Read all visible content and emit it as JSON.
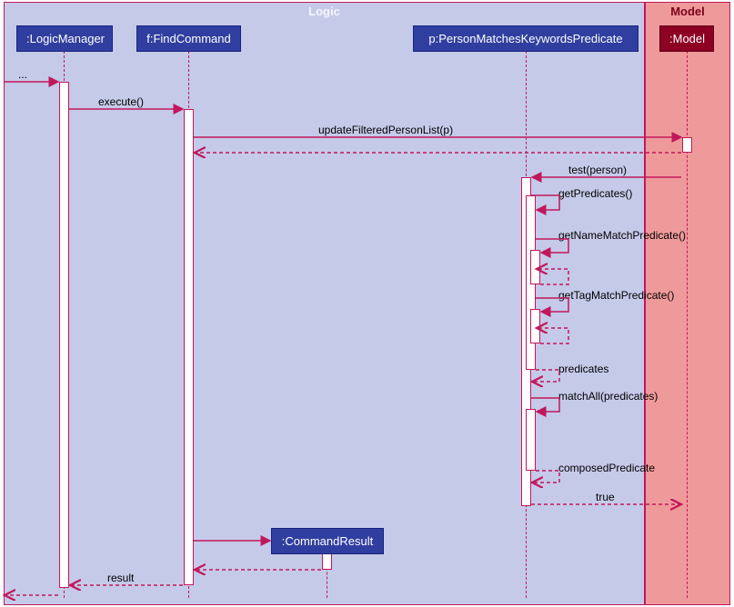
{
  "frames": {
    "logic": {
      "label": "Logic"
    },
    "model": {
      "label": "Model"
    }
  },
  "participants": {
    "logicManager": ":LogicManager",
    "findCommand": "f:FindCommand",
    "predicate": "p:PersonMatchesKeywordsPredicate",
    "commandResult": ":CommandResult",
    "model": ":Model"
  },
  "messages": {
    "dots": "...",
    "execute": "execute()",
    "updateFiltered": "updateFilteredPersonList(p)",
    "testPerson": "test(person)",
    "getPredicates": "getPredicates()",
    "getNameMatch": "getNameMatchPredicate()",
    "getTagMatch": "getTagMatchPredicate()",
    "predicates": "predicates",
    "matchAll": "matchAll(predicates)",
    "composedPredicate": "composedPredicate",
    "returnTrue": "true",
    "result": "result"
  },
  "chart_data": {
    "type": "sequence-diagram",
    "frames": [
      {
        "name": "Logic",
        "participants": [
          ":LogicManager",
          "f:FindCommand",
          "p:PersonMatchesKeywordsPredicate",
          ":CommandResult"
        ]
      },
      {
        "name": "Model",
        "participants": [
          ":Model"
        ]
      }
    ],
    "lifelines": [
      ":LogicManager",
      "f:FindCommand",
      "p:PersonMatchesKeywordsPredicate",
      ":CommandResult",
      ":Model"
    ],
    "interactions": [
      {
        "from": "external",
        "to": ":LogicManager",
        "label": "...",
        "type": "call"
      },
      {
        "from": ":LogicManager",
        "to": "f:FindCommand",
        "label": "execute()",
        "type": "call"
      },
      {
        "from": "f:FindCommand",
        "to": ":Model",
        "label": "updateFilteredPersonList(p)",
        "type": "call"
      },
      {
        "from": ":Model",
        "to": "f:FindCommand",
        "label": "",
        "type": "return"
      },
      {
        "from": ":Model",
        "to": "p:PersonMatchesKeywordsPredicate",
        "label": "test(person)",
        "type": "call"
      },
      {
        "from": "p:PersonMatchesKeywordsPredicate",
        "to": "p:PersonMatchesKeywordsPredicate",
        "label": "getPredicates()",
        "type": "self-call"
      },
      {
        "from": "p:PersonMatchesKeywordsPredicate",
        "to": "p:PersonMatchesKeywordsPredicate",
        "label": "getNameMatchPredicate()",
        "type": "self-call"
      },
      {
        "from": "p:PersonMatchesKeywordsPredicate",
        "to": "p:PersonMatchesKeywordsPredicate",
        "label": "getTagMatchPredicate()",
        "type": "self-call"
      },
      {
        "from": "p:PersonMatchesKeywordsPredicate",
        "to": "p:PersonMatchesKeywordsPredicate",
        "label": "predicates",
        "type": "self-return"
      },
      {
        "from": "p:PersonMatchesKeywordsPredicate",
        "to": "p:PersonMatchesKeywordsPredicate",
        "label": "matchAll(predicates)",
        "type": "self-call"
      },
      {
        "from": "p:PersonMatchesKeywordsPredicate",
        "to": "p:PersonMatchesKeywordsPredicate",
        "label": "composedPredicate",
        "type": "self-return"
      },
      {
        "from": "p:PersonMatchesKeywordsPredicate",
        "to": ":Model",
        "label": "true",
        "type": "return"
      },
      {
        "from": "f:FindCommand",
        "to": ":CommandResult",
        "label": "",
        "type": "create"
      },
      {
        "from": ":CommandResult",
        "to": "f:FindCommand",
        "label": "",
        "type": "return"
      },
      {
        "from": "f:FindCommand",
        "to": ":LogicManager",
        "label": "result",
        "type": "return"
      },
      {
        "from": ":LogicManager",
        "to": "external",
        "label": "",
        "type": "return"
      }
    ]
  }
}
